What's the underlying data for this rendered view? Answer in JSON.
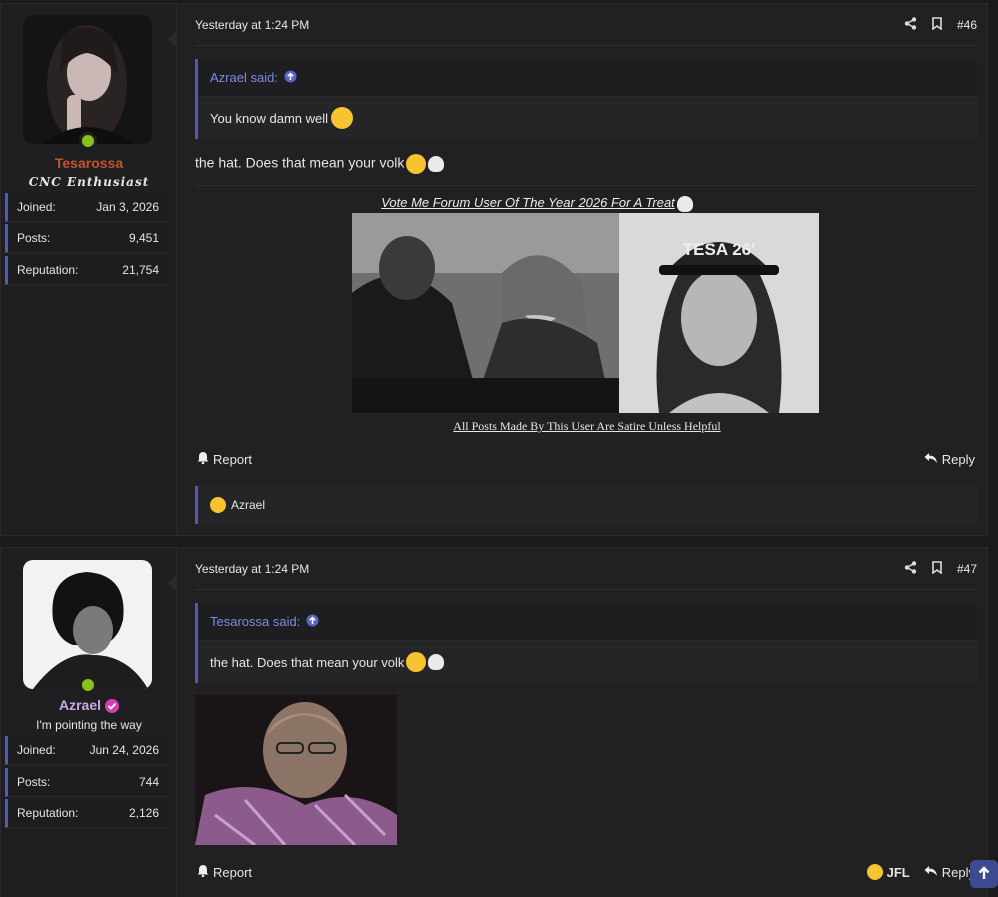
{
  "posts": [
    {
      "user": {
        "name": "Tesarossa",
        "title": "CNC Enthusiast",
        "stats": [
          {
            "label": "Joined:",
            "value": "Jan 3, 2026"
          },
          {
            "label": "Posts:",
            "value": "9,451"
          },
          {
            "label": "Reputation:",
            "value": "21,754"
          }
        ]
      },
      "timestamp": "Yesterday at 1:24 PM",
      "number": "#46",
      "quote": {
        "author": "Azrael said:",
        "text": "You know damn well"
      },
      "body": "the hat. Does that mean your volk",
      "signature": {
        "title": "Vote Me Forum User Of The Year 2026 For A Treat",
        "hat_text": "TESA 26'",
        "footer": "All Posts Made By This User Are Satire Unless Helpful"
      },
      "actions": {
        "report": "Report",
        "reply": "Reply"
      },
      "reactions": {
        "user": "Azrael"
      }
    },
    {
      "user": {
        "name": "Azrael",
        "title": "I'm pointing the way",
        "stats": [
          {
            "label": "Joined:",
            "value": "Jun 24, 2026"
          },
          {
            "label": "Posts:",
            "value": "744"
          },
          {
            "label": "Reputation:",
            "value": "2,126"
          }
        ]
      },
      "timestamp": "Yesterday at 1:24 PM",
      "number": "#47",
      "quote": {
        "author": "Tesarossa said:",
        "text": "the hat. Does that mean your volk"
      },
      "actions": {
        "report": "Report",
        "reply": "Reply"
      },
      "reactions": {
        "user": "JFL"
      }
    }
  ],
  "colors": {
    "accent": "#4f5bb4",
    "online": "#8ac01a",
    "quote_author": "#7e8ae0"
  },
  "icons": [
    "share-icon",
    "bookmark-icon",
    "bell-icon",
    "reply-icon",
    "arrow-up-icon",
    "verified-icon"
  ]
}
